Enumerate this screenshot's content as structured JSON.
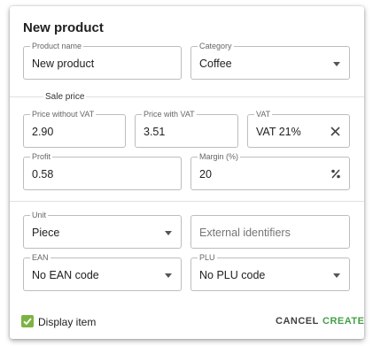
{
  "dialog": {
    "title": "New product"
  },
  "fields": {
    "product_name": {
      "label": "Product name",
      "value": "New product"
    },
    "category": {
      "label": "Category",
      "value": "Coffee"
    },
    "sale_price_section": "Sale price",
    "price_without_vat": {
      "label": "Price without VAT",
      "value": "2.90"
    },
    "price_with_vat": {
      "label": "Price with VAT",
      "value": "3.51"
    },
    "vat": {
      "label": "VAT",
      "value": "VAT 21%"
    },
    "profit": {
      "label": "Profit",
      "value": "0.58"
    },
    "margin": {
      "label": "Margin (%)",
      "value": "20"
    },
    "unit": {
      "label": "Unit",
      "value": "Piece"
    },
    "external_identifiers": {
      "placeholder": "External identifiers"
    },
    "ean": {
      "label": "EAN",
      "value": "No EAN code"
    },
    "plu": {
      "label": "PLU",
      "value": "No PLU code"
    }
  },
  "footer": {
    "display_item_label": "Display item",
    "display_item_checked": true,
    "cancel_label": "CANCEL",
    "create_label": "CREATE"
  },
  "colors": {
    "accent": "#43a047",
    "checkbox": "#7cb342",
    "border": "#bdbdbd"
  },
  "icons": {
    "vat_clear": "close-icon",
    "margin_toggle": "percent-icon",
    "dropdown": "chevron-down-icon"
  }
}
